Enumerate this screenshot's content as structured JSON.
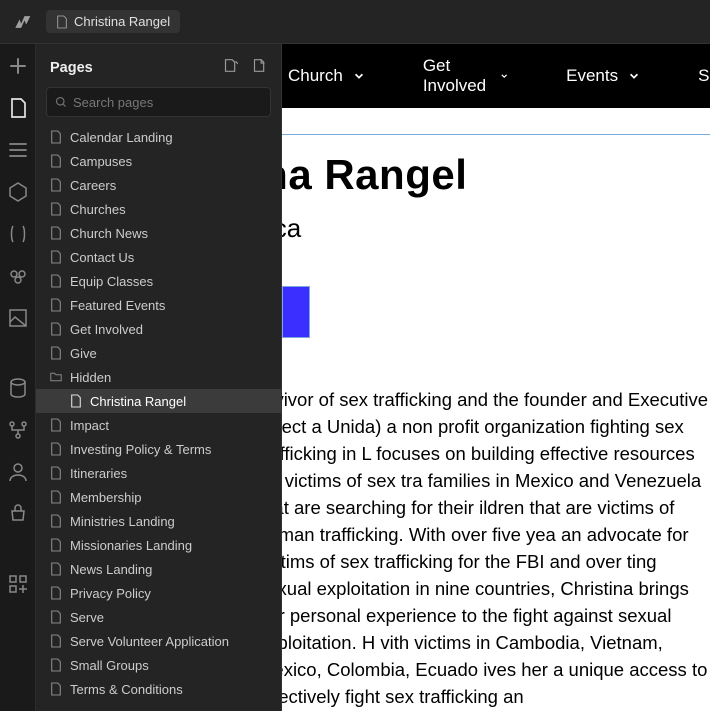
{
  "breadcrumb": {
    "current": "Christina Rangel"
  },
  "panel": {
    "title": "Pages",
    "search_placeholder": "Search pages"
  },
  "pages": [
    {
      "label": "Calendar Landing",
      "type": "file"
    },
    {
      "label": "Campuses",
      "type": "file"
    },
    {
      "label": "Careers",
      "type": "file"
    },
    {
      "label": "Churches",
      "type": "file"
    },
    {
      "label": "Church News",
      "type": "file"
    },
    {
      "label": "Contact Us",
      "type": "file"
    },
    {
      "label": "Equip Classes",
      "type": "file"
    },
    {
      "label": "Featured Events",
      "type": "file"
    },
    {
      "label": "Get Involved",
      "type": "file"
    },
    {
      "label": "Give",
      "type": "file"
    },
    {
      "label": "Hidden",
      "type": "folder"
    },
    {
      "label": "Christina Rangel",
      "type": "file",
      "child": true,
      "selected": true
    },
    {
      "label": "Impact",
      "type": "file"
    },
    {
      "label": "Investing Policy & Terms",
      "type": "file"
    },
    {
      "label": "Itineraries",
      "type": "file"
    },
    {
      "label": "Membership",
      "type": "file"
    },
    {
      "label": "Ministries Landing",
      "type": "file"
    },
    {
      "label": "Missionaries Landing",
      "type": "file"
    },
    {
      "label": "News Landing",
      "type": "file"
    },
    {
      "label": "Privacy Policy",
      "type": "file"
    },
    {
      "label": "Serve",
      "type": "file"
    },
    {
      "label": "Serve Volunteer Application",
      "type": "file"
    },
    {
      "label": "Small Groups",
      "type": "file"
    },
    {
      "label": "Terms & Conditions",
      "type": "file"
    }
  ],
  "nav": {
    "items": [
      {
        "label": "Church"
      },
      {
        "label": "Get Involved"
      },
      {
        "label": "Events"
      },
      {
        "label": "Schoo"
      }
    ]
  },
  "page_content": {
    "title_fragment": "ina Rangel",
    "subtitle_fragment": "ica",
    "body": "urvivor of sex trafficking and the founder and Executive Direct a Unida) a non profit organization fighting sex trafficking in L focuses on building effective resources for victims of sex tra families in Mexico and Venezuela that are searching for their ildren that are victims of human trafficking. With over five yea an advocate for victims of sex trafficking for the FBI and over ting sexual exploitation in nine countries, Christina brings her personal experience to the fight against sexual exploitation. H vith victims in Cambodia, Vietnam, Mexico, Colombia, Ecuado ives her a unique access to effectively fight sex trafficking an"
  }
}
